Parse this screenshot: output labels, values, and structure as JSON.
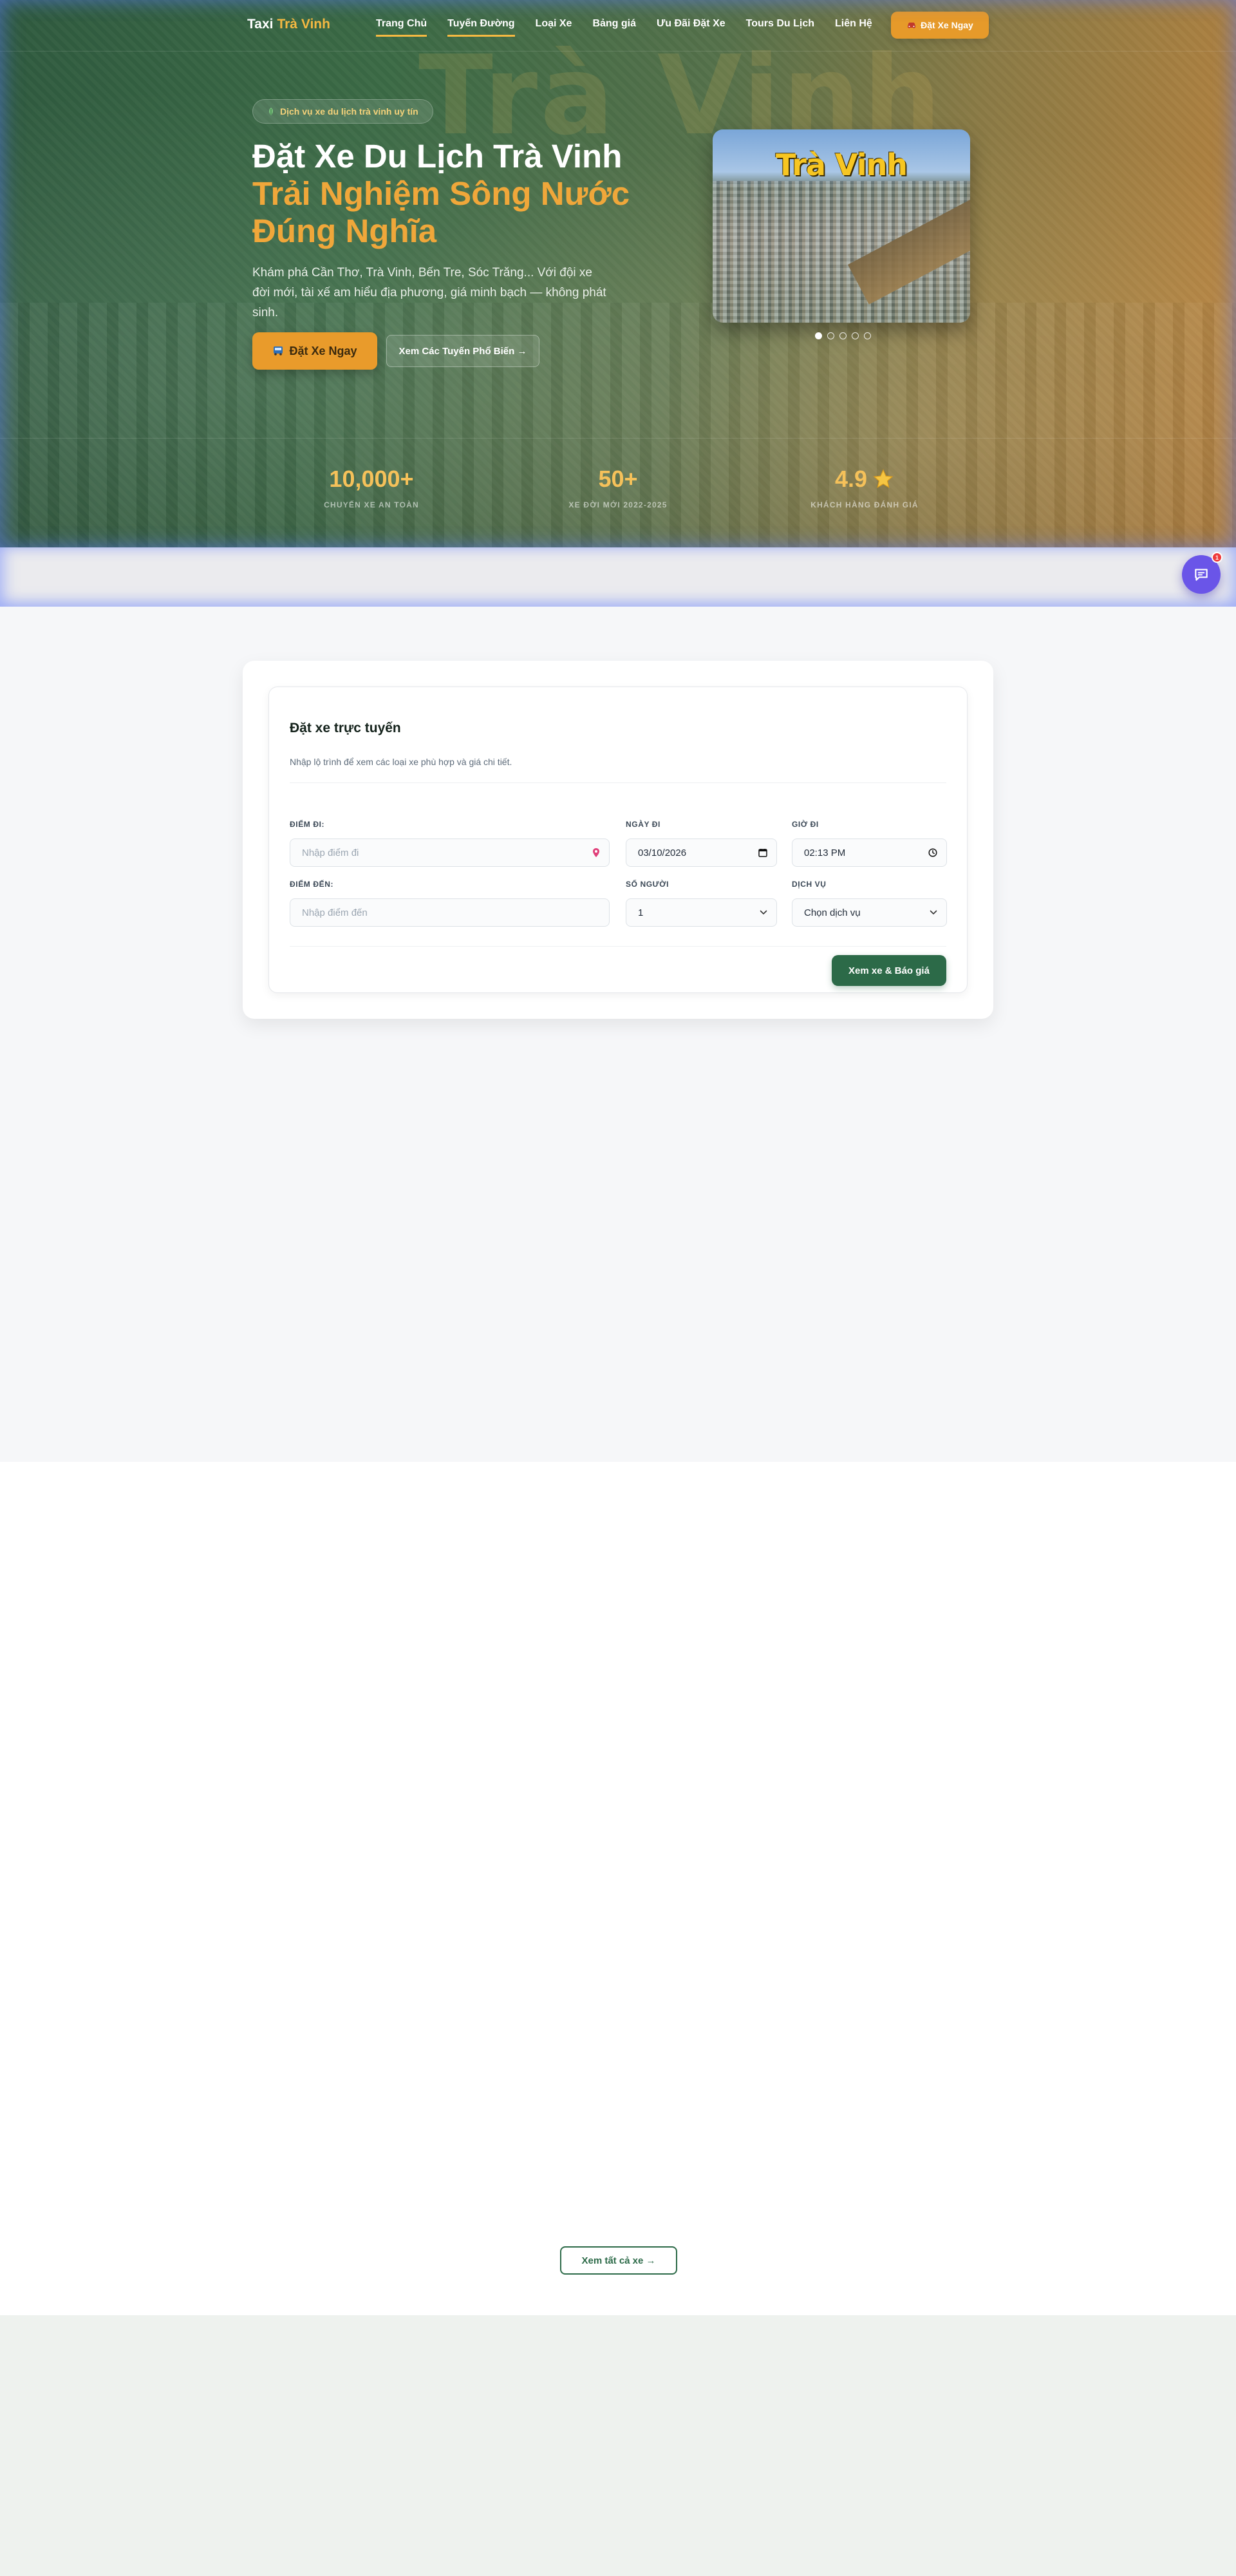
{
  "nav": {
    "logo_main": "Taxi",
    "logo_accent": "Trà Vinh",
    "items": [
      {
        "label": "Trang Chủ",
        "active": true
      },
      {
        "label": "Tuyến Đường",
        "active": true
      },
      {
        "label": "Loại Xe",
        "active": false
      },
      {
        "label": "Bảng giá",
        "active": false
      },
      {
        "label": "Ưu Đãi Đặt Xe",
        "active": false
      },
      {
        "label": "Tours Du Lịch",
        "active": false
      },
      {
        "label": "Liên Hệ",
        "active": false
      }
    ],
    "cta_label": "Đặt Xe Ngay",
    "cta_icon": "car-icon"
  },
  "hero": {
    "watermark": "Trà Vinh",
    "badge": "Dịch vụ xe du lịch trà vinh uy tín",
    "title_line1": "Đặt Xe Du Lịch Trà Vinh",
    "title_line2": "Trải Nghiệm Sông Nước Đúng Nghĩa",
    "description": "Khám phá Cần Thơ, Trà Vinh, Bến Tre, Sóc Trăng... Với đội xe đời mới, tài xế am hiểu địa phương, giá minh bạch — không phát sinh.",
    "primary_button": "Đặt Xe Ngay",
    "secondary_button": "Xem Các Tuyến Phổ Biến →",
    "image_title": "Trà Vinh",
    "slides_total": 5,
    "slide_active": 1,
    "stats": [
      {
        "value": "10,000+",
        "label": "CHUYẾN XE AN TOÀN"
      },
      {
        "value": "50+",
        "label": "XE ĐỜI MỚI 2022-2025"
      },
      {
        "value": "4.9",
        "label": "KHÁCH HÀNG ĐÁNH GIÁ",
        "icon": "star-icon"
      }
    ]
  },
  "chat": {
    "badge_count": "1"
  },
  "booking": {
    "title": "Đặt xe trực tuyến",
    "subtitle": "Nhập lộ trình để xem các loại xe phù hợp và giá chi tiết.",
    "from_label": "ĐIỂM ĐI:",
    "from_placeholder": "Nhập điểm đi",
    "date_label": "NGÀY ĐI",
    "date_value": "03/10/2026",
    "time_label": "GIỜ ĐI",
    "time_value": "02:13 PM",
    "to_label": "ĐIỂM ĐẾN:",
    "to_placeholder": "Nhập điểm đến",
    "people_label": "SỐ NGƯỜI",
    "people_value": "1",
    "service_label": "DỊCH VỤ",
    "service_value": "Chọn dịch vụ",
    "submit": "Xem xe & Báo giá"
  },
  "cars": {
    "view_all": "Xem tất cả xe →"
  },
  "colors": {
    "accent": "#e99b2b",
    "brand_green": "#2c6a48",
    "chat": "#6a55e8"
  }
}
